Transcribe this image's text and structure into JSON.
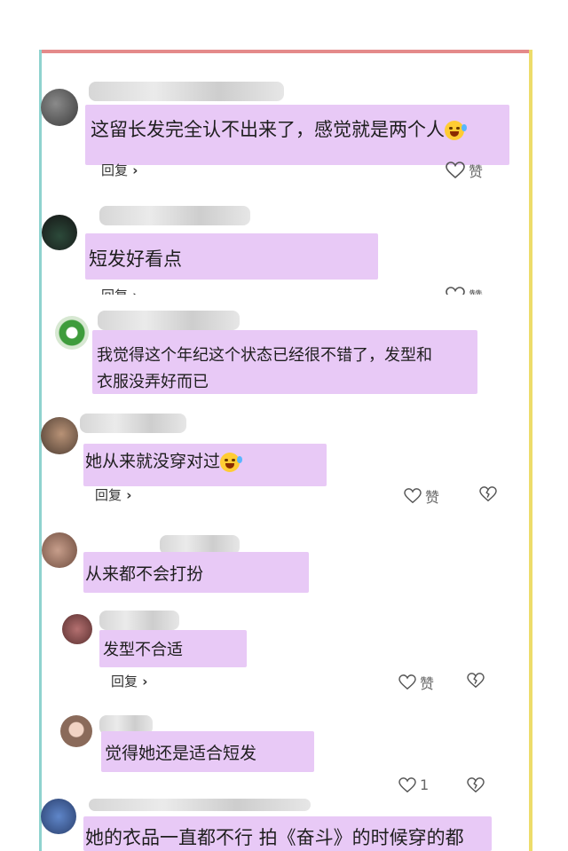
{
  "comments": [
    {
      "text": "这留长发完全认不出来了，感觉就是两个人",
      "reply": "回复",
      "like": "赞"
    },
    {
      "text": "短发好看点",
      "reply": "回复",
      "like": "赞"
    },
    {
      "text_line1": "我觉得这个年纪这个状态已经很不错了，发型和",
      "text_line2": "衣服没弄好而已"
    },
    {
      "text": "她从来就没穿对过",
      "reply": "回复",
      "like": "赞"
    },
    {
      "text": "从来都不会打扮"
    },
    {
      "text": "发型不合适",
      "reply": "回复",
      "like": "赞"
    },
    {
      "text": "觉得她还是适合短发",
      "like_count": "1"
    },
    {
      "text": "她的衣品一直都不行 拍《奋斗》的时候穿的都"
    }
  ],
  "colors": {
    "highlight": "#e8c9f6",
    "frame_top": "#e48a8a",
    "frame_left": "#8fd3cf",
    "frame_right": "#eddc6a"
  },
  "icons": [
    "heart-outline-icon",
    "broken-heart-icon",
    "laughing-tears-emoji"
  ]
}
